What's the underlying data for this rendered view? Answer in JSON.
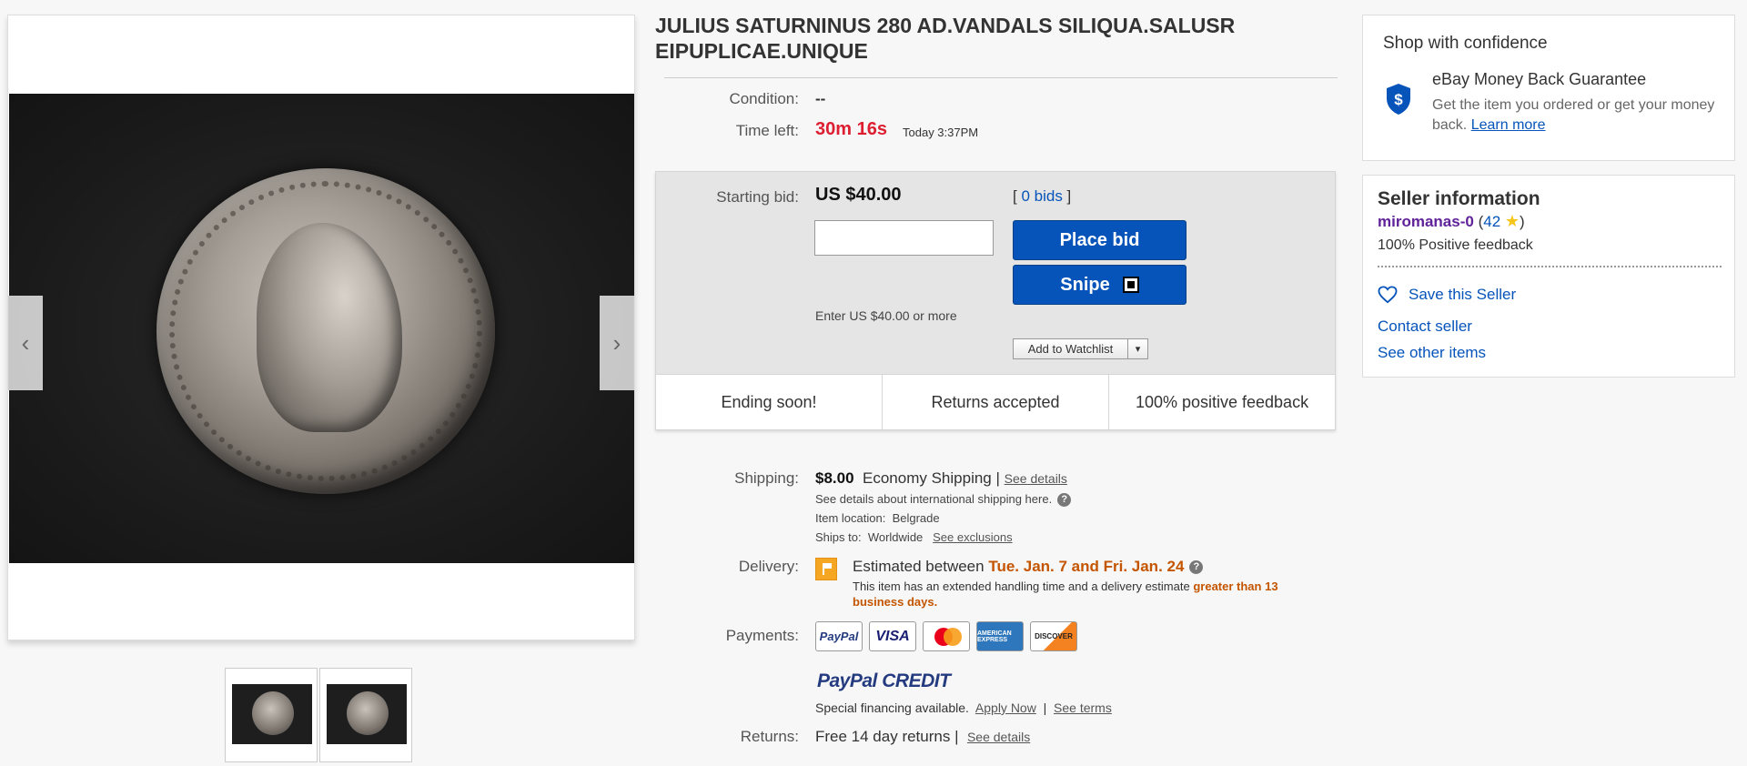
{
  "listing": {
    "title": "JULIUS SATURNINUS 280 AD.VANDALS SILIQUA.SALUSR EIPUPLICAE.UNIQUE",
    "condition_label": "Condition:",
    "condition_value": "--",
    "time_left_label": "Time left:",
    "time_left_value": "30m 16s",
    "time_left_sub": "Today 3:37PM"
  },
  "gallery": {
    "prev_glyph": "‹",
    "next_glyph": "›"
  },
  "bidding": {
    "starting_bid_label": "Starting bid:",
    "starting_bid_value": "US $40.00",
    "bids_open": "[ ",
    "bids_link": "0 bids",
    "bids_close": " ]",
    "bid_input_value": "",
    "place_bid_label": "Place bid",
    "snipe_label": "Snipe",
    "bid_hint": "Enter US $40.00 or more",
    "watchlist_label": "Add to Watchlist",
    "watchlist_caret": "▾"
  },
  "features": [
    "Ending soon!",
    "Returns accepted",
    "100% positive feedback"
  ],
  "shipping": {
    "label": "Shipping:",
    "price": "$8.00",
    "method": "Economy Shipping |",
    "see_details": "See details",
    "intl_note": "See details about international shipping here.",
    "qmark": "?",
    "location_label": "Item location:",
    "location_value": "Belgrade",
    "ships_to_label": "Ships to:",
    "ships_to_value": "Worldwide",
    "see_exclusions": "See exclusions"
  },
  "delivery": {
    "label": "Delivery:",
    "prefix": "Estimated between",
    "dates": "Tue. Jan. 7 and Fri. Jan. 24",
    "note_prefix": "This item has an extended handling time and a delivery estimate",
    "note_highlight": "greater than 13 business days."
  },
  "payments": {
    "label": "Payments:",
    "methods": [
      "PayPal",
      "VISA",
      "mastercard",
      "AMERICAN EXPRESS",
      "DISCOVER"
    ],
    "paypal_credit_a": "PayPal",
    "paypal_credit_b": "CREDIT",
    "financing": "Special financing available.",
    "apply_now": "Apply Now",
    "separator": "|",
    "see_terms": "See terms"
  },
  "returns": {
    "label": "Returns:",
    "value": "Free 14 day returns |",
    "see_details": "See details"
  },
  "confidence": {
    "title": "Shop with confidence",
    "guarantee_title": "eBay Money Back Guarantee",
    "guarantee_body": "Get the item you ordered or get your money back.",
    "learn_more": "Learn more"
  },
  "seller": {
    "title": "Seller information",
    "name": "miromanas-0",
    "score_open": "(",
    "score": "42",
    "score_close": ")",
    "star": "★",
    "feedback": "100% Positive feedback",
    "save_label": "Save this Seller",
    "contact_label": "Contact seller",
    "other_items_label": "See other items"
  },
  "colors": {
    "link_blue": "#0654ba",
    "time_red": "#dd1e31",
    "delivery_orange": "#c45500",
    "seller_purple": "#5f2299"
  }
}
